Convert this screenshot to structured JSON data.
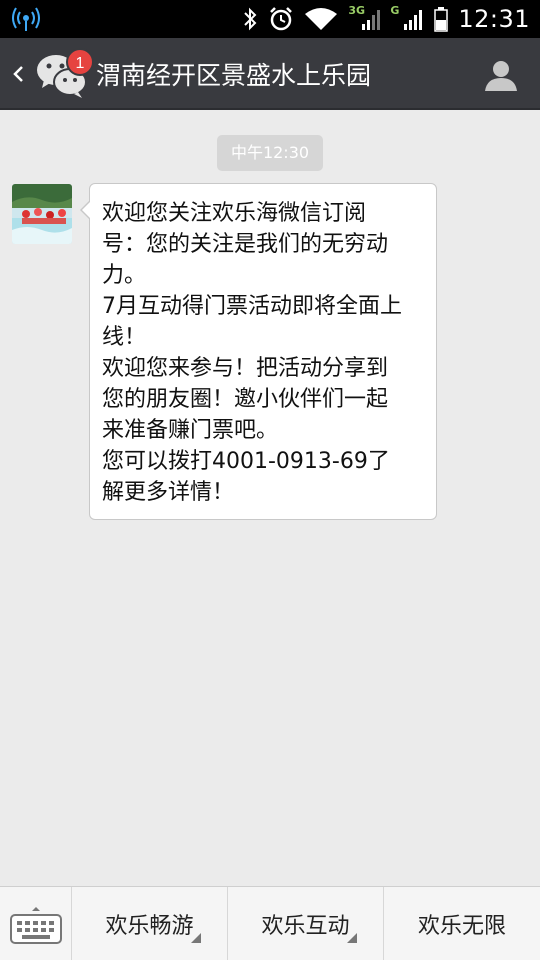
{
  "status_bar": {
    "network_3g": "3G",
    "network_g": "G",
    "time": "12:31"
  },
  "header": {
    "unread_count": "1",
    "title": "渭南经开区景盛水上乐园"
  },
  "chat": {
    "timestamp": "中午12:30",
    "message_lines": [
      "欢迎您关注欢乐海微信订阅",
      "号：您的关注是我们的无穷动",
      "力。",
      "7月互动得门票活动即将全面上",
      "线！",
      "欢迎您来参与！把活动分享到",
      "您的朋友圈！邀小伙伴们一起",
      "来准备赚门票吧。",
      "您可以拨打4001-0913-69了",
      "解更多详情！"
    ]
  },
  "bottom_menu": {
    "items": [
      {
        "label": "欢乐畅游",
        "has_submenu": true
      },
      {
        "label": "欢乐互动",
        "has_submenu": true
      },
      {
        "label": "欢乐无限",
        "has_submenu": false
      }
    ]
  },
  "colors": {
    "titlebar": "#393a3f",
    "background": "#ebebeb",
    "badge": "#e64340",
    "bubble": "#ffffff"
  }
}
